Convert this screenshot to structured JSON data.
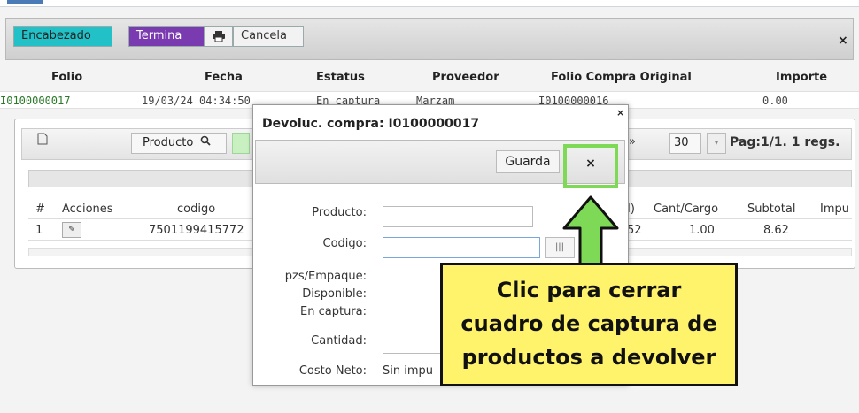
{
  "toolbar": {
    "encabezado": "Encabezado",
    "termina": "Termina",
    "print_icon": "print-icon",
    "cancela": "Cancela",
    "close": "×"
  },
  "grid": {
    "headers": [
      "Folio",
      "Fecha",
      "Estatus",
      "Proveedor",
      "Folio Compra Original",
      "Importe"
    ],
    "row": [
      "I0100000017",
      "19/03/24 04:34:50",
      "En captura",
      "Marzam",
      "I0100000016",
      "0.00"
    ]
  },
  "detail": {
    "producto_btn": "Producto",
    "pager_next": "»",
    "rows_per_page": "30",
    "pager_text": "Pag:1/1. 1 regs.",
    "headers": [
      "#",
      "Acciones",
      "codigo",
      "I)",
      "Cant/Cargo",
      "Subtotal",
      "Impu"
    ],
    "row": [
      "1",
      "7501199415772",
      "52",
      "1.00",
      "8.62"
    ]
  },
  "modal": {
    "title": "Devoluc. compra: I0100000017",
    "close": "×",
    "guarda": "Guarda",
    "close_btn": "×",
    "labels": {
      "producto": "Producto:",
      "codigo": "Codigo:",
      "pzs_empaque": "pzs/Empaque:",
      "disponible": "Disponible:",
      "en_captura": "En captura:",
      "cantidad": "Cantidad:",
      "costo_neto": "Costo Neto:"
    },
    "costo_neto_value": "Sin impu"
  },
  "callout": {
    "line1": "Clic para cerrar",
    "line2": "cuadro de captura de",
    "line3": "productos a devolver",
    "color": "#fff36b",
    "highlight_color": "#7ed957"
  }
}
